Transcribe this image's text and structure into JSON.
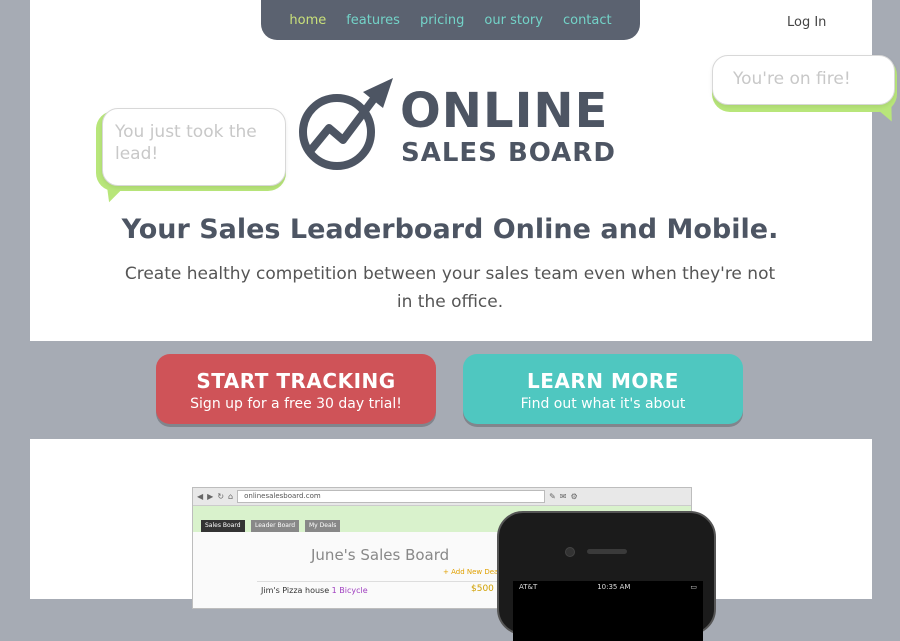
{
  "nav": {
    "items": [
      {
        "label": "home",
        "active": true
      },
      {
        "label": "features"
      },
      {
        "label": "pricing"
      },
      {
        "label": "our story"
      },
      {
        "label": "contact"
      }
    ],
    "login": "Log In"
  },
  "bubbles": {
    "left": "You just took the lead!",
    "right": "You're on fire!"
  },
  "logo": {
    "line1": "ONLINE",
    "line2": "SALES BOARD"
  },
  "hero": {
    "headline": "Your Sales Leaderboard Online and Mobile.",
    "subhead": "Create healthy competition between your sales team even when they're not in the office."
  },
  "cta": {
    "start": {
      "title": "START TRACKING",
      "sub": "Sign up for a free 30 day trial!",
      "color": "#cf5358"
    },
    "learn": {
      "title": "LEARN MORE",
      "sub": "Find out what it's about",
      "color": "#4fc7c0"
    }
  },
  "browser": {
    "url": "onlinesalesboard.com",
    "tabs": [
      "Sales Board",
      "Leader Board",
      "My Deals"
    ],
    "board_title": "June's Sales Board",
    "add_deal": "+ Add New Deal",
    "deal": {
      "name": "Jim's Pizza house",
      "item": "1 Bicycle",
      "amount": "$500"
    }
  },
  "phone": {
    "carrier": "AT&T",
    "time": "10:35 AM"
  },
  "colors": {
    "nav_bg": "#5b6270",
    "accent_teal": "#4fc7c0",
    "accent_red": "#cf5358",
    "bubble_green": "#b8e67a",
    "heading": "#4d5563"
  }
}
